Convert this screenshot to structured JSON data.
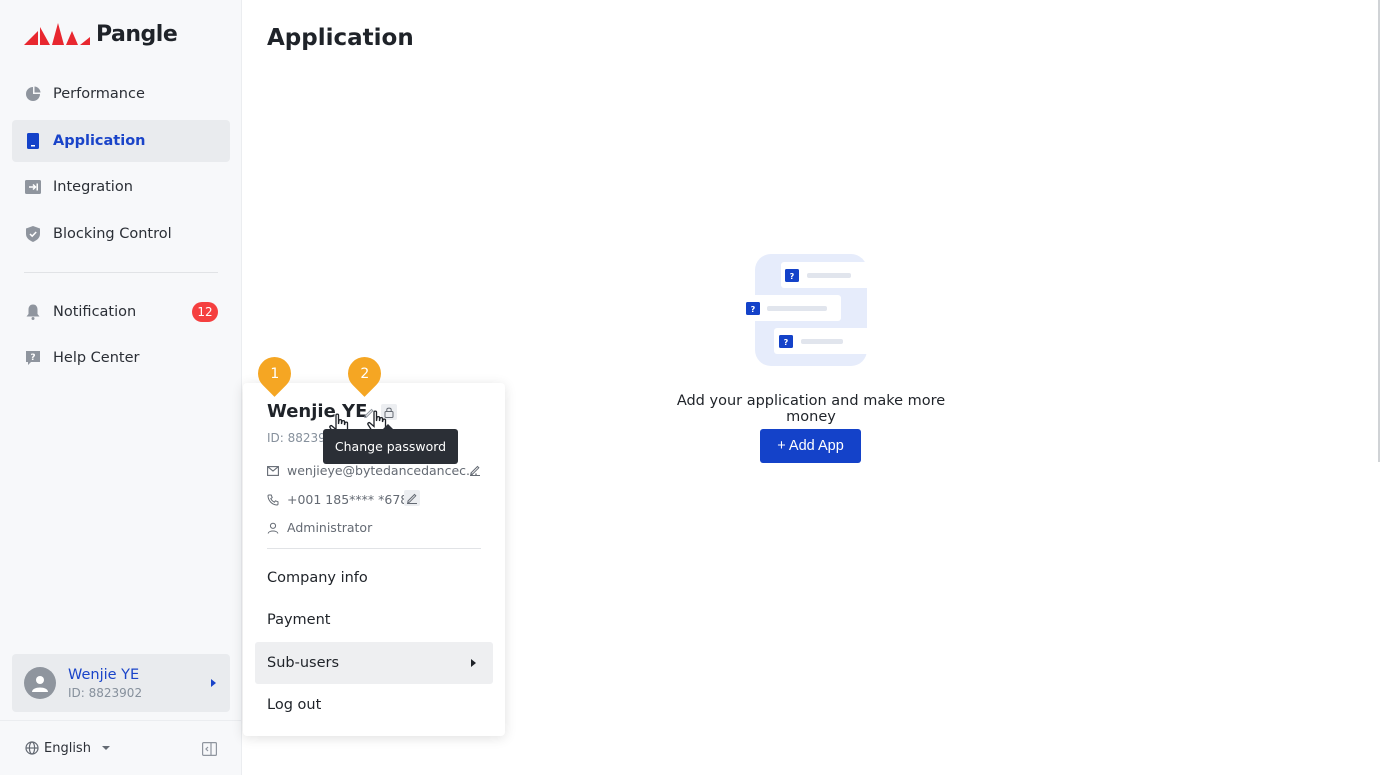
{
  "brand": {
    "name": "Pangle",
    "accent": "#1442c9",
    "logo_red": "#e8272f"
  },
  "sidebar": {
    "items": [
      {
        "label": "Performance",
        "icon": "pie-chart-icon"
      },
      {
        "label": "Application",
        "icon": "app-icon",
        "active": true
      },
      {
        "label": "Integration",
        "icon": "integration-icon"
      },
      {
        "label": "Blocking Control",
        "icon": "shield-icon"
      }
    ],
    "secondary": [
      {
        "label": "Notification",
        "icon": "bell-icon",
        "badge": "12"
      },
      {
        "label": "Help Center",
        "icon": "help-icon"
      }
    ],
    "user": {
      "name": "Wenjie YE",
      "id": "ID: 8823902"
    },
    "language": "English"
  },
  "main": {
    "title": "Application",
    "empty_message": "Add your application and make more money",
    "add_button": "+ Add App"
  },
  "popup": {
    "name": "Wenjie YE",
    "id": "ID: 882390",
    "email": "wenjieye@bytedancedancec...",
    "phone": "+001 185**** *678",
    "role": "Administrator",
    "tooltip": "Change password",
    "menu": {
      "company": "Company info",
      "payment": "Payment",
      "subusers": "Sub-users",
      "logout": "Log out"
    }
  },
  "markers": {
    "one": "1",
    "two": "2"
  }
}
